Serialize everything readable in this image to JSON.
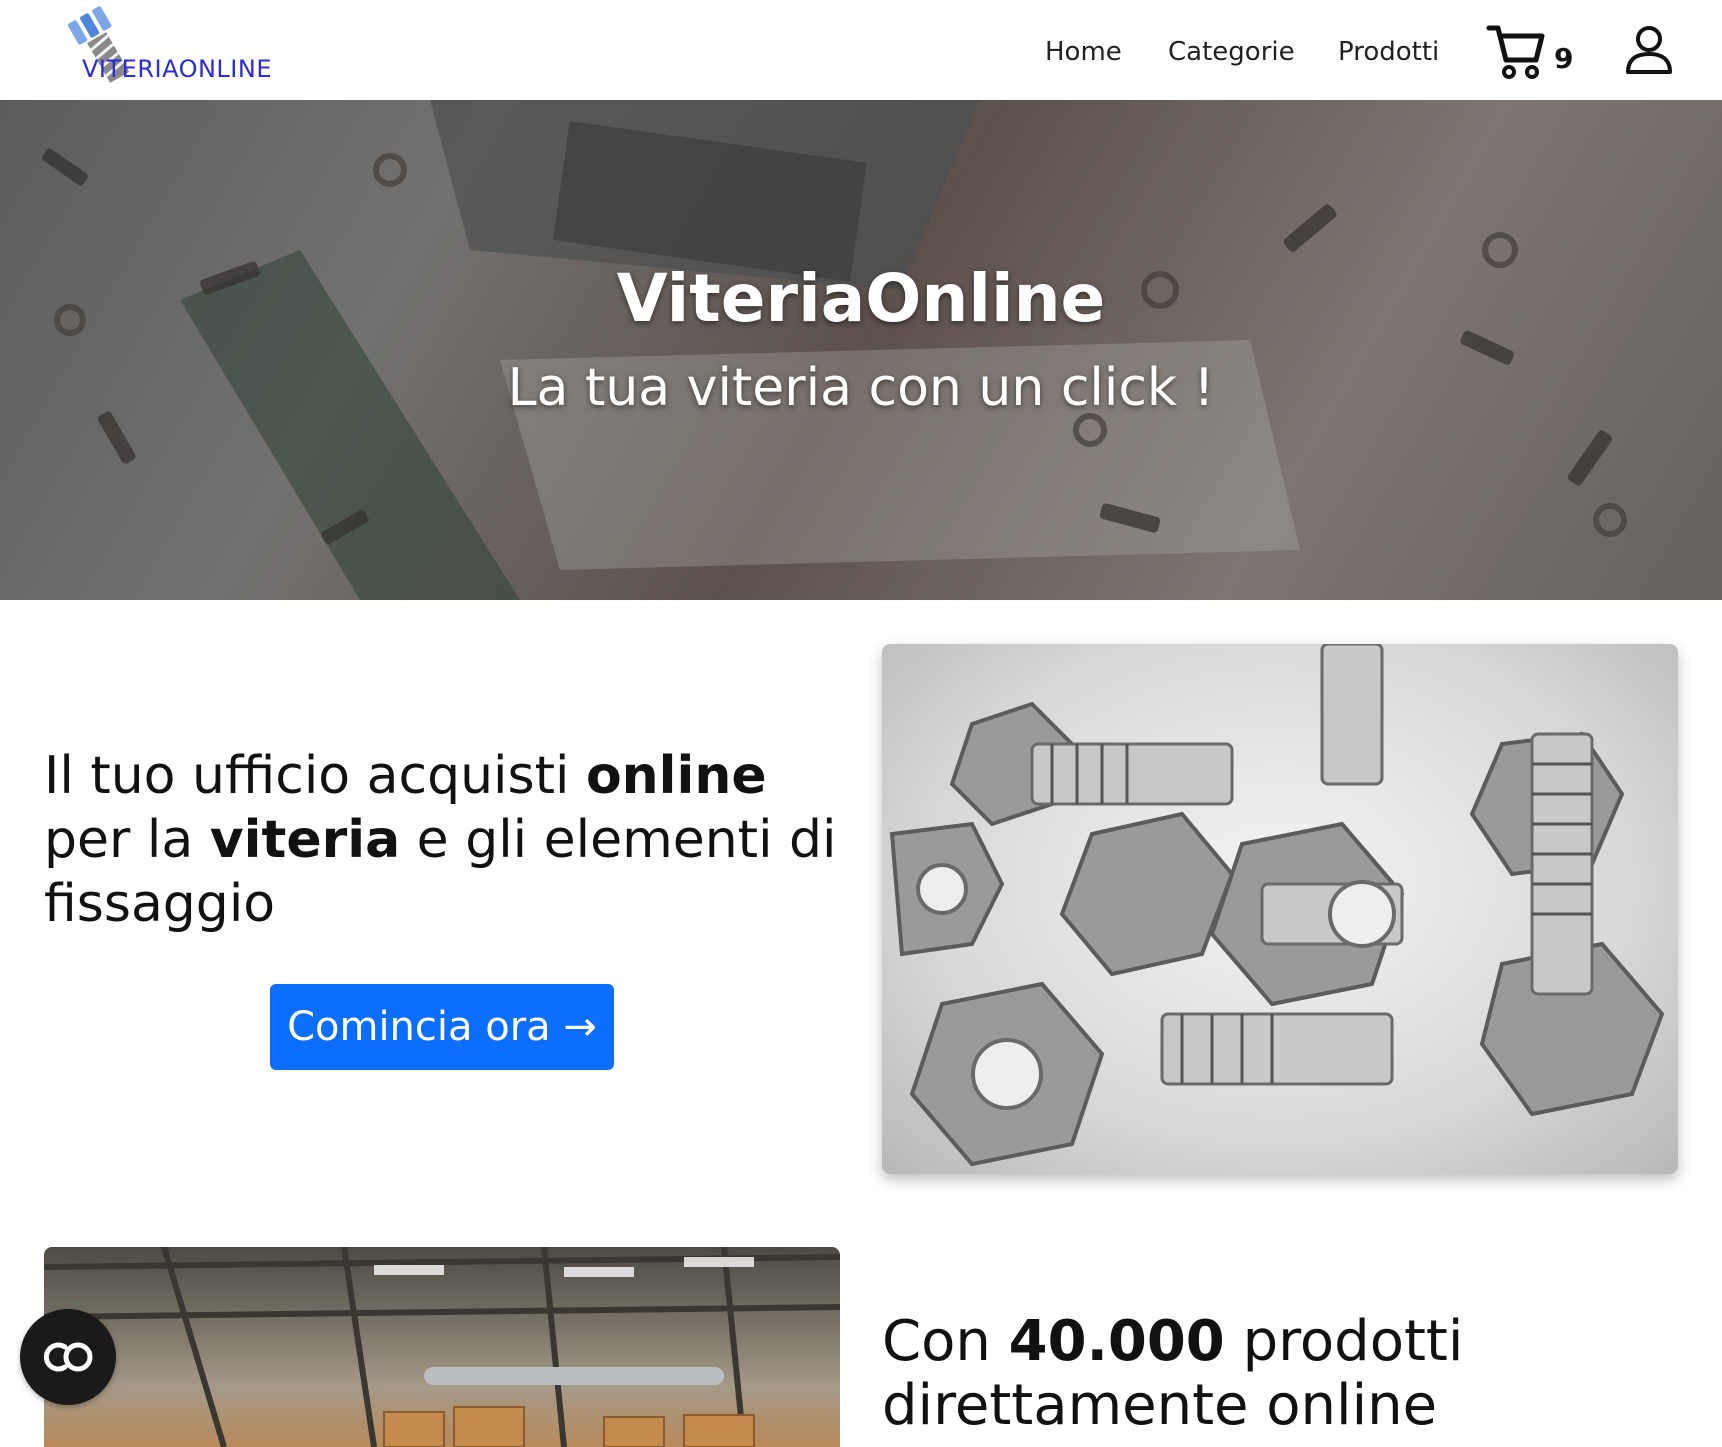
{
  "header": {
    "logo_text": "VITERIAONLINE",
    "nav": [
      "Home",
      "Categorie",
      "Prodotti"
    ],
    "cart_count": "9"
  },
  "hero": {
    "title": "ViteriaOnline",
    "subtitle": "La tua viteria con un click !"
  },
  "intro": {
    "part1": "Il tuo ufficio acquisti ",
    "bold1": "online",
    "part2": " per la ",
    "bold2": "viteria",
    "part3": " e gli elementi di fissaggio",
    "cta": "Comincia ora →"
  },
  "products": {
    "part1": "Con ",
    "bold1": "40.000",
    "part2": " prodotti",
    "line2": "direttamente online"
  },
  "colors": {
    "primary_button": "#0d6efd",
    "logo_blue": "#2b2bd9"
  },
  "icons": [
    "cart-icon",
    "user-icon",
    "accessibility-icon"
  ]
}
